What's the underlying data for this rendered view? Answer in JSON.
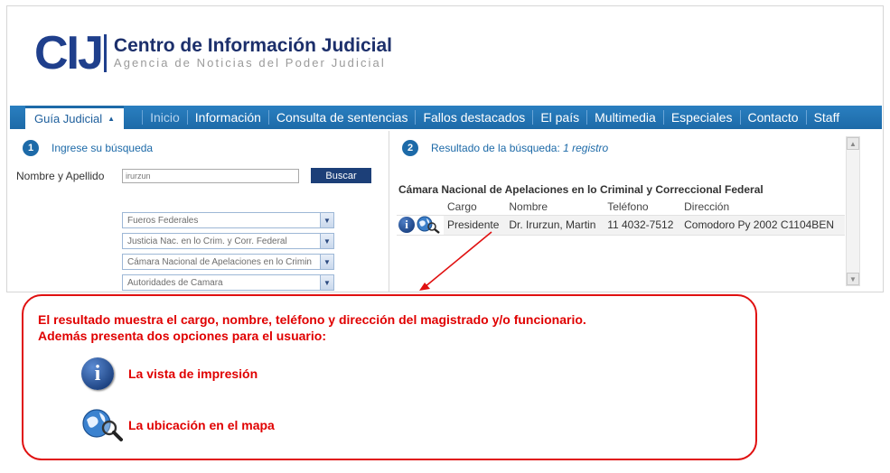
{
  "header": {
    "logo_mark": "CIJ",
    "title": "Centro de Información Judicial",
    "subtitle": "Agencia de Noticias del Poder Judicial"
  },
  "nav": {
    "guia_label": "Guía Judicial",
    "items": [
      "Inicio",
      "Información",
      "Consulta de sentencias",
      "Fallos destacados",
      "El país",
      "Multimedia",
      "Especiales",
      "Contacto",
      "Staff"
    ]
  },
  "search": {
    "step_number": "1",
    "step_label": "Ingrese su búsqueda",
    "name_label": "Nombre y Apellido",
    "name_value": "irurzun",
    "button_label": "Buscar",
    "selects": [
      "Fueros Federales",
      "Justicia Nac. en lo Crim. y Corr. Federal",
      "Cámara Nacional de Apelaciones en lo Crimin",
      "Autoridades de Camara"
    ]
  },
  "results": {
    "step_number": "2",
    "step_label": "Resultado de la búsqueda:",
    "count_text": "1 registro",
    "court": "Cámara Nacional de Apelaciones en lo Criminal y Correccional Federal",
    "columns": [
      "Cargo",
      "Nombre",
      "Teléfono",
      "Dirección"
    ],
    "rows": [
      {
        "cargo": "Presidente",
        "nombre": "Dr. Irurzun, Martin",
        "telefono": "11 4032-7512",
        "direccion": "Comodoro Py 2002 C1104BEN"
      }
    ]
  },
  "callout": {
    "line1": "El resultado muestra el cargo, nombre, teléfono y dirección del magistrado y/o funcionario.",
    "line2": "Además presenta dos opciones para el usuario:",
    "option1": "La vista de impresión",
    "option2": "La ubicación en el mapa",
    "color": "#e00000"
  },
  "colors": {
    "nav": "#1d6aa8",
    "brand": "#1f3f8c"
  }
}
